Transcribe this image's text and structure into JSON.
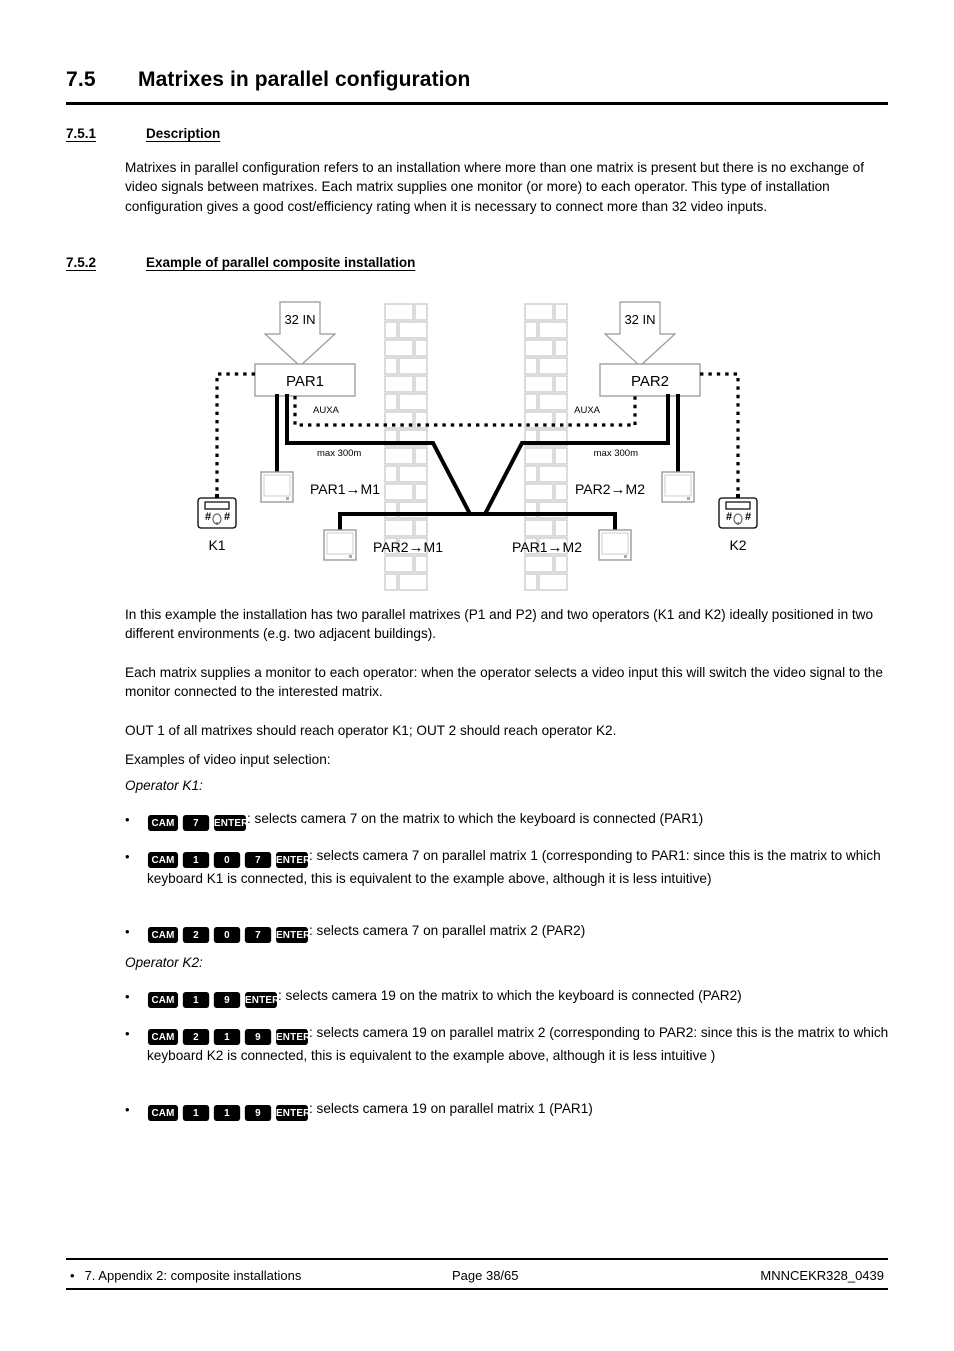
{
  "section": {
    "number": "7.5",
    "title": "Matrixes in parallel configuration"
  },
  "subsections": [
    {
      "number": "7.5.1",
      "title": "Description"
    },
    {
      "number": "7.5.2",
      "title": "Example of parallel composite installation"
    }
  ],
  "paragraphs": {
    "description": "Matrixes in parallel configuration refers to an installation where more than one matrix is present but there is no exchange of video signals between matrixes. Each matrix supplies one monitor (or more) to each operator. This type of installation configuration gives a good cost/efficiency rating when it is necessary to connect more than 32 video inputs.",
    "example_1": "In this example the installation has two parallel matrixes (P1 and P2) and two operators (K1 and K2) ideally positioned in two different environments (e.g. two adjacent buildings).",
    "example_2": "Each matrix supplies a monitor to each operator: when the operator selects a video input this will switch the video signal to the monitor connected to the interested matrix.",
    "example_3": "OUT 1 of all matrixes should reach operator K1; OUT 2 should reach operator K2.",
    "examples_intro": "Examples of video input selection:"
  },
  "operator_labels": {
    "k1": "Operator K1:",
    "k2": "Operator K2:"
  },
  "bullets": [
    {
      "keys": [
        "CAM",
        "7",
        "ENTER"
      ],
      "text": ": selects camera 7 on the matrix to which the keyboard is connected (PAR1)"
    },
    {
      "keys": [
        "CAM",
        "1",
        "0",
        "7",
        "ENTER"
      ],
      "text": ": selects camera 7 on parallel matrix 1 (corresponding to PAR1: since this is the matrix to which keyboard K1 is connected, this is equivalent to the example above, although it is less intuitive)"
    },
    {
      "keys": [
        "CAM",
        "2",
        "0",
        "7",
        "ENTER"
      ],
      "text": ": selects camera 7 on parallel matrix 2 (PAR2)"
    },
    {
      "keys": [
        "CAM",
        "1",
        "9",
        "ENTER"
      ],
      "text": ": selects camera 19 on the matrix to which the keyboard is connected (PAR2)"
    },
    {
      "keys": [
        "CAM",
        "2",
        "1",
        "9",
        "ENTER"
      ],
      "text": ": selects camera 19 on parallel matrix 2 (corresponding to PAR2: since this is the matrix to which keyboard K2 is connected, this is equivalent to the example above, although it is less intuitive )"
    },
    {
      "keys": [
        "CAM",
        "1",
        "1",
        "9",
        "ENTER"
      ],
      "text": ": selects camera 19 on parallel matrix 1 (PAR1)"
    }
  ],
  "bullet_marker": "•",
  "diagram": {
    "input_left": "32 IN",
    "input_right": "32 IN",
    "matrix_left": "PAR1",
    "matrix_right": "PAR2",
    "aux_left": "AUXA",
    "aux_right": "AUXA",
    "distance_left": "max 300m",
    "distance_right": "max 300m",
    "monitor_top_left": "PAR1→M1",
    "monitor_bottom_left": "PAR2→M1",
    "monitor_top_right": "PAR2→M2",
    "monitor_bottom_right": "PAR1→M2",
    "keyboard_left": "K1",
    "keyboard_right": "K2",
    "colors": {
      "line": "#000000",
      "box_outline": "#808080",
      "wall_brick": "#cccccc"
    }
  },
  "footer": {
    "marker": "•",
    "left": "7. Appendix 2: composite installations",
    "page": "Page 38/65",
    "doc_id": "MNNCEKR328_0439"
  }
}
